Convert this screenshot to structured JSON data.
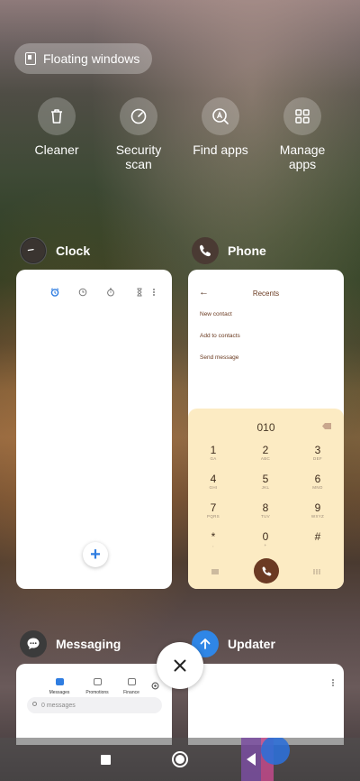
{
  "floating_windows": {
    "label": "Floating windows"
  },
  "quick_actions": [
    {
      "label": "Cleaner",
      "icon": "trash-icon"
    },
    {
      "label": "Security\nscan",
      "icon": "security-scan-icon"
    },
    {
      "label": "Find apps",
      "icon": "find-apps-icon"
    },
    {
      "label": "Manage\napps",
      "icon": "grid-icon"
    }
  ],
  "apps": {
    "clock": {
      "name": "Clock"
    },
    "phone": {
      "name": "Phone"
    },
    "messaging": {
      "name": "Messaging"
    },
    "updater": {
      "name": "Updater"
    }
  },
  "phone_card": {
    "title": "Recents",
    "links": [
      "New contact",
      "Add to contacts",
      "Send message"
    ],
    "dialed_number": "010",
    "keys": [
      {
        "digit": "1",
        "letters": "GA"
      },
      {
        "digit": "2",
        "letters": "ABC"
      },
      {
        "digit": "3",
        "letters": "DEF"
      },
      {
        "digit": "4",
        "letters": "GHI"
      },
      {
        "digit": "5",
        "letters": "JKL"
      },
      {
        "digit": "6",
        "letters": "MNO"
      },
      {
        "digit": "7",
        "letters": "PQRS"
      },
      {
        "digit": "8",
        "letters": "TUV"
      },
      {
        "digit": "9",
        "letters": "WXYZ"
      },
      {
        "digit": "*",
        "letters": ","
      },
      {
        "digit": "0",
        "letters": "+"
      },
      {
        "digit": "#",
        "letters": ""
      }
    ]
  },
  "clock_card": {
    "add_label": "+"
  },
  "messaging_card": {
    "tabs": [
      "Messages",
      "Promotions",
      "Finance"
    ],
    "search_placeholder": "0 messages"
  },
  "colors": {
    "phone_brown": "#6b3a23",
    "dialpad_bg": "#fcebc3",
    "updater_blue": "#2f86e6",
    "clock_blue": "#2f7de1"
  }
}
